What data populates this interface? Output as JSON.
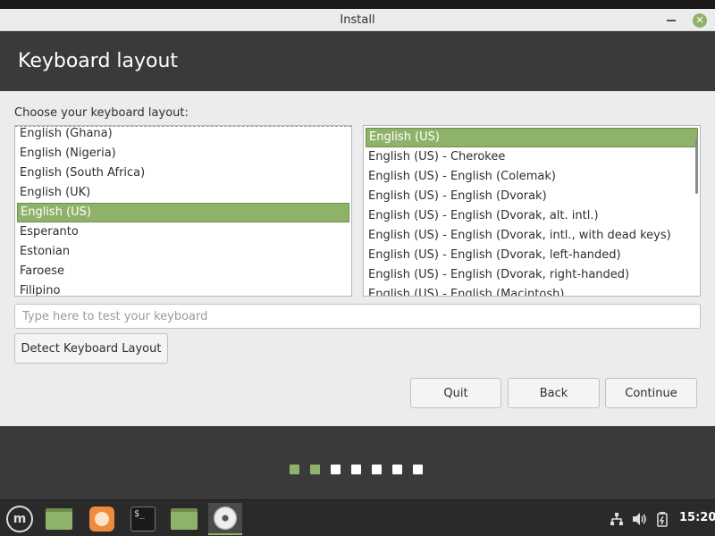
{
  "window": {
    "title": "Install"
  },
  "header": {
    "title": "Keyboard layout"
  },
  "prompt": "Choose your keyboard layout:",
  "layouts": [
    "English (Ghana)",
    "English (Nigeria)",
    "English (South Africa)",
    "English (UK)",
    "English (US)",
    "Esperanto",
    "Estonian",
    "Faroese",
    "Filipino"
  ],
  "layouts_selected": "English (US)",
  "variants": [
    "English (US)",
    "English (US) - Cherokee",
    "English (US) - English (Colemak)",
    "English (US) - English (Dvorak)",
    "English (US) - English (Dvorak, alt. intl.)",
    "English (US) - English (Dvorak, intl., with dead keys)",
    "English (US) - English (Dvorak, left-handed)",
    "English (US) - English (Dvorak, right-handed)",
    "English (US) - English (Macintosh)"
  ],
  "variants_selected": "English (US)",
  "test_input": {
    "value": "",
    "placeholder": "Type here to test your keyboard"
  },
  "buttons": {
    "detect": "Detect Keyboard Layout",
    "quit": "Quit",
    "back": "Back",
    "continue": "Continue"
  },
  "progress": {
    "total_steps": 7,
    "completed_steps": 2
  },
  "taskbar": {
    "items": [
      "mint-menu",
      "show-desktop",
      "firefox",
      "terminal",
      "files",
      "installer"
    ],
    "active": "installer",
    "terminal_glyph": "$_",
    "mint_glyph": "m"
  },
  "tray": {
    "clock": "15:20"
  },
  "colors": {
    "accent": "#8fb26a",
    "header_bg": "#3a3a3a",
    "content_bg": "#ececec",
    "taskbar_bg": "#2a2a2a"
  }
}
